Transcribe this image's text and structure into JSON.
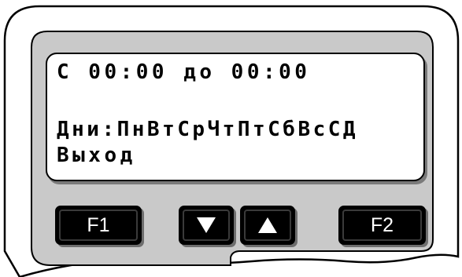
{
  "display": {
    "line1": "С 00:00 до 00:00",
    "line2": "",
    "line3": "Дни:ПнВтСрЧтПтСбВсСД",
    "line4": "Выход"
  },
  "buttons": {
    "f1_label": "F1",
    "down_icon": "triangle-down-icon",
    "up_icon": "triangle-up-icon",
    "f2_label": "F2"
  },
  "colors": {
    "device_panel": "#c8c8c8",
    "display_bg": "#ffffff",
    "button_bg": "#000000",
    "button_text": "#ffffff"
  }
}
